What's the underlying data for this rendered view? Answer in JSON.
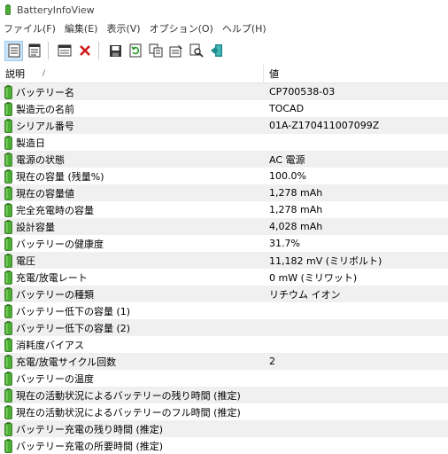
{
  "app": {
    "title": "BatteryInfoView"
  },
  "menu": [
    "ファイル(F)",
    "編集(E)",
    "表示(V)",
    "オプション(O)",
    "ヘルプ(H)"
  ],
  "toolbar": [
    {
      "name": "html-report-view-icon"
    },
    {
      "name": "text-view-icon"
    },
    {
      "sep": true
    },
    {
      "name": "properties-window-icon"
    },
    {
      "name": "delete-icon"
    },
    {
      "sep": true
    },
    {
      "name": "save-icon"
    },
    {
      "name": "refresh-icon"
    },
    {
      "name": "copy-icon"
    },
    {
      "name": "properties-icon"
    },
    {
      "name": "find-icon"
    },
    {
      "name": "exit-icon"
    }
  ],
  "columns": {
    "description": "説明",
    "sort_indicator": "/",
    "value": "値"
  },
  "rows": [
    {
      "name": "バッテリー名",
      "value": "CP700538-03"
    },
    {
      "name": "製造元の名前",
      "value": "TOCAD"
    },
    {
      "name": "シリアル番号",
      "value": "01A-Z170411007099Z"
    },
    {
      "name": "製造日",
      "value": ""
    },
    {
      "name": "電源の状態",
      "value": "AC 電源"
    },
    {
      "name": "現在の容量 (残量%)",
      "value": "100.0%"
    },
    {
      "name": "現在の容量値",
      "value": "1,278 mAh"
    },
    {
      "name": "完全充電時の容量",
      "value": "1,278 mAh"
    },
    {
      "name": "設計容量",
      "value": "4,028 mAh"
    },
    {
      "name": "バッテリーの健康度",
      "value": "31.7%"
    },
    {
      "name": "電圧",
      "value": "11,182 mV (ミリボルト)"
    },
    {
      "name": "充電/放電レート",
      "value": "0 mW (ミリワット)"
    },
    {
      "name": "バッテリーの種類",
      "value": "リチウム イオン"
    },
    {
      "name": "バッテリー低下の容量 (1)",
      "value": ""
    },
    {
      "name": "バッテリー低下の容量 (2)",
      "value": ""
    },
    {
      "name": "消耗度バイアス",
      "value": ""
    },
    {
      "name": "充電/放電サイクル回数",
      "value": "2"
    },
    {
      "name": "バッテリーの温度",
      "value": ""
    },
    {
      "name": "現在の活動状況によるバッテリーの残り時間 (推定)",
      "value": ""
    },
    {
      "name": "現在の活動状況によるバッテリーのフル時間 (推定)",
      "value": ""
    },
    {
      "name": "バッテリー充電の残り時間 (推定)",
      "value": ""
    },
    {
      "name": "バッテリー充電の所要時間 (推定)",
      "value": ""
    }
  ],
  "colors": {
    "battery_green": "#4caf35",
    "selected_button": "#cce4f7",
    "alt_row": "#f0f0f0"
  }
}
